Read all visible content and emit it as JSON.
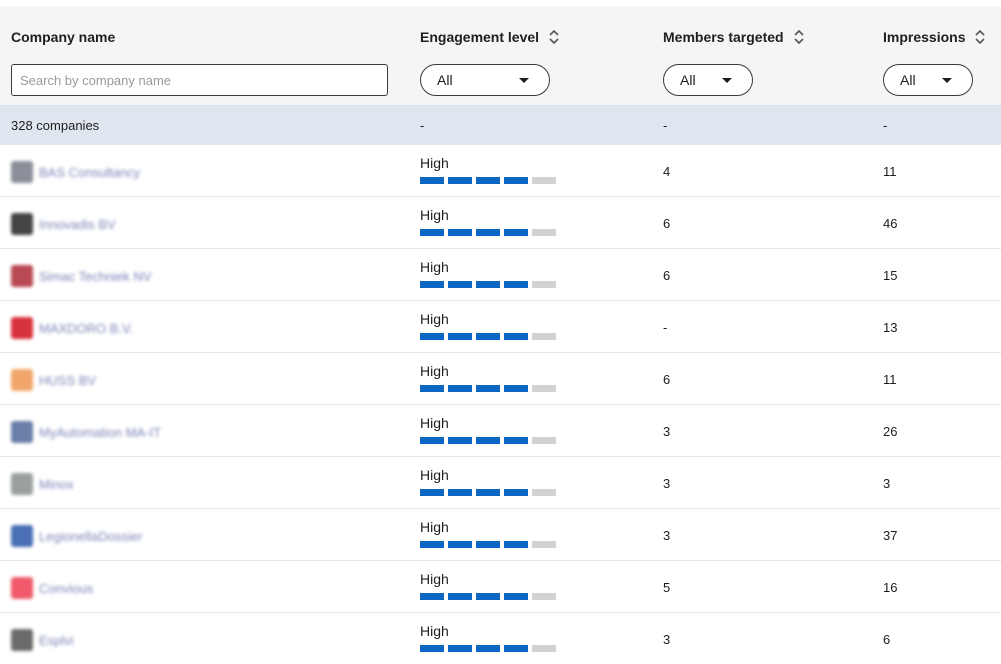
{
  "header": {
    "columns": {
      "company": "Company name",
      "engagement": "Engagement level",
      "members": "Members targeted",
      "impressions": "Impressions"
    },
    "search_placeholder": "Search by company name",
    "filters": {
      "engagement": "All",
      "members": "All",
      "impressions": "All"
    }
  },
  "summary": {
    "count": "328 companies",
    "engagement": "-",
    "members": "-",
    "impressions": "-"
  },
  "engagement_scale": {
    "segments": 5
  },
  "colors": {
    "bar_on": "#0a66c2",
    "bar_off": "#d2d2d2",
    "summary_bg": "#dfe6ef",
    "header_bg": "#f4f5f7"
  },
  "rows": [
    {
      "company": "BAS Consultancy",
      "logo_color": "#8a8f99",
      "engagement": "High",
      "level": 4,
      "members": "4",
      "impressions": "11"
    },
    {
      "company": "Innovadis BV",
      "logo_color": "#444444",
      "engagement": "High",
      "level": 4,
      "members": "6",
      "impressions": "46"
    },
    {
      "company": "Simac Techniek NV",
      "logo_color": "#b94a55",
      "engagement": "High",
      "level": 4,
      "members": "6",
      "impressions": "15"
    },
    {
      "company": "MAXDORO B.V.",
      "logo_color": "#d8323c",
      "engagement": "High",
      "level": 4,
      "members": "-",
      "impressions": "13"
    },
    {
      "company": "HUSS BV",
      "logo_color": "#f2a66a",
      "engagement": "High",
      "level": 4,
      "members": "6",
      "impressions": "11"
    },
    {
      "company": "MyAutomation MA-IT",
      "logo_color": "#6a7fa8",
      "engagement": "High",
      "level": 4,
      "members": "3",
      "impressions": "26"
    },
    {
      "company": "Minox",
      "logo_color": "#9aa0a0",
      "engagement": "High",
      "level": 4,
      "members": "3",
      "impressions": "3"
    },
    {
      "company": "LegionellaDossier",
      "logo_color": "#4a6fb5",
      "engagement": "High",
      "level": 4,
      "members": "3",
      "impressions": "37"
    },
    {
      "company": "Convious",
      "logo_color": "#f05a6a",
      "engagement": "High",
      "level": 4,
      "members": "5",
      "impressions": "16"
    },
    {
      "company": "Esplvi",
      "logo_color": "#6b6b6b",
      "engagement": "High",
      "level": 4,
      "members": "3",
      "impressions": "6"
    }
  ]
}
